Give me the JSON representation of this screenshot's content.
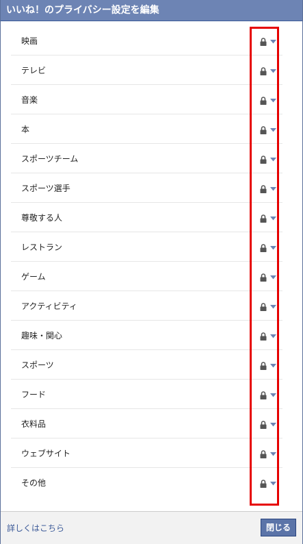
{
  "dialog": {
    "title": "いいね！のプライバシー設定を編集"
  },
  "categories": [
    {
      "label": "映画",
      "privacy_icon": "lock-icon"
    },
    {
      "label": "テレビ",
      "privacy_icon": "lock-icon"
    },
    {
      "label": "音楽",
      "privacy_icon": "lock-icon"
    },
    {
      "label": "本",
      "privacy_icon": "lock-icon"
    },
    {
      "label": "スポーツチーム",
      "privacy_icon": "lock-icon"
    },
    {
      "label": "スポーツ選手",
      "privacy_icon": "lock-icon"
    },
    {
      "label": "尊敬する人",
      "privacy_icon": "lock-icon"
    },
    {
      "label": "レストラン",
      "privacy_icon": "lock-icon"
    },
    {
      "label": "ゲーム",
      "privacy_icon": "lock-icon"
    },
    {
      "label": "アクティビティ",
      "privacy_icon": "lock-icon"
    },
    {
      "label": "趣味・関心",
      "privacy_icon": "lock-icon"
    },
    {
      "label": "スポーツ",
      "privacy_icon": "lock-icon"
    },
    {
      "label": "フード",
      "privacy_icon": "lock-icon"
    },
    {
      "label": "衣料品",
      "privacy_icon": "lock-icon"
    },
    {
      "label": "ウェブサイト",
      "privacy_icon": "lock-icon"
    },
    {
      "label": "その他",
      "privacy_icon": "lock-icon"
    }
  ],
  "footer": {
    "learn_more": "詳しくはこちら",
    "close_label": "閉じる"
  },
  "colors": {
    "header_bg": "#6d84b4",
    "link": "#3b5998",
    "button_bg": "#5b74a8",
    "highlight": "#e60000",
    "lock": "#555555",
    "arrow": "#6d84b4"
  }
}
